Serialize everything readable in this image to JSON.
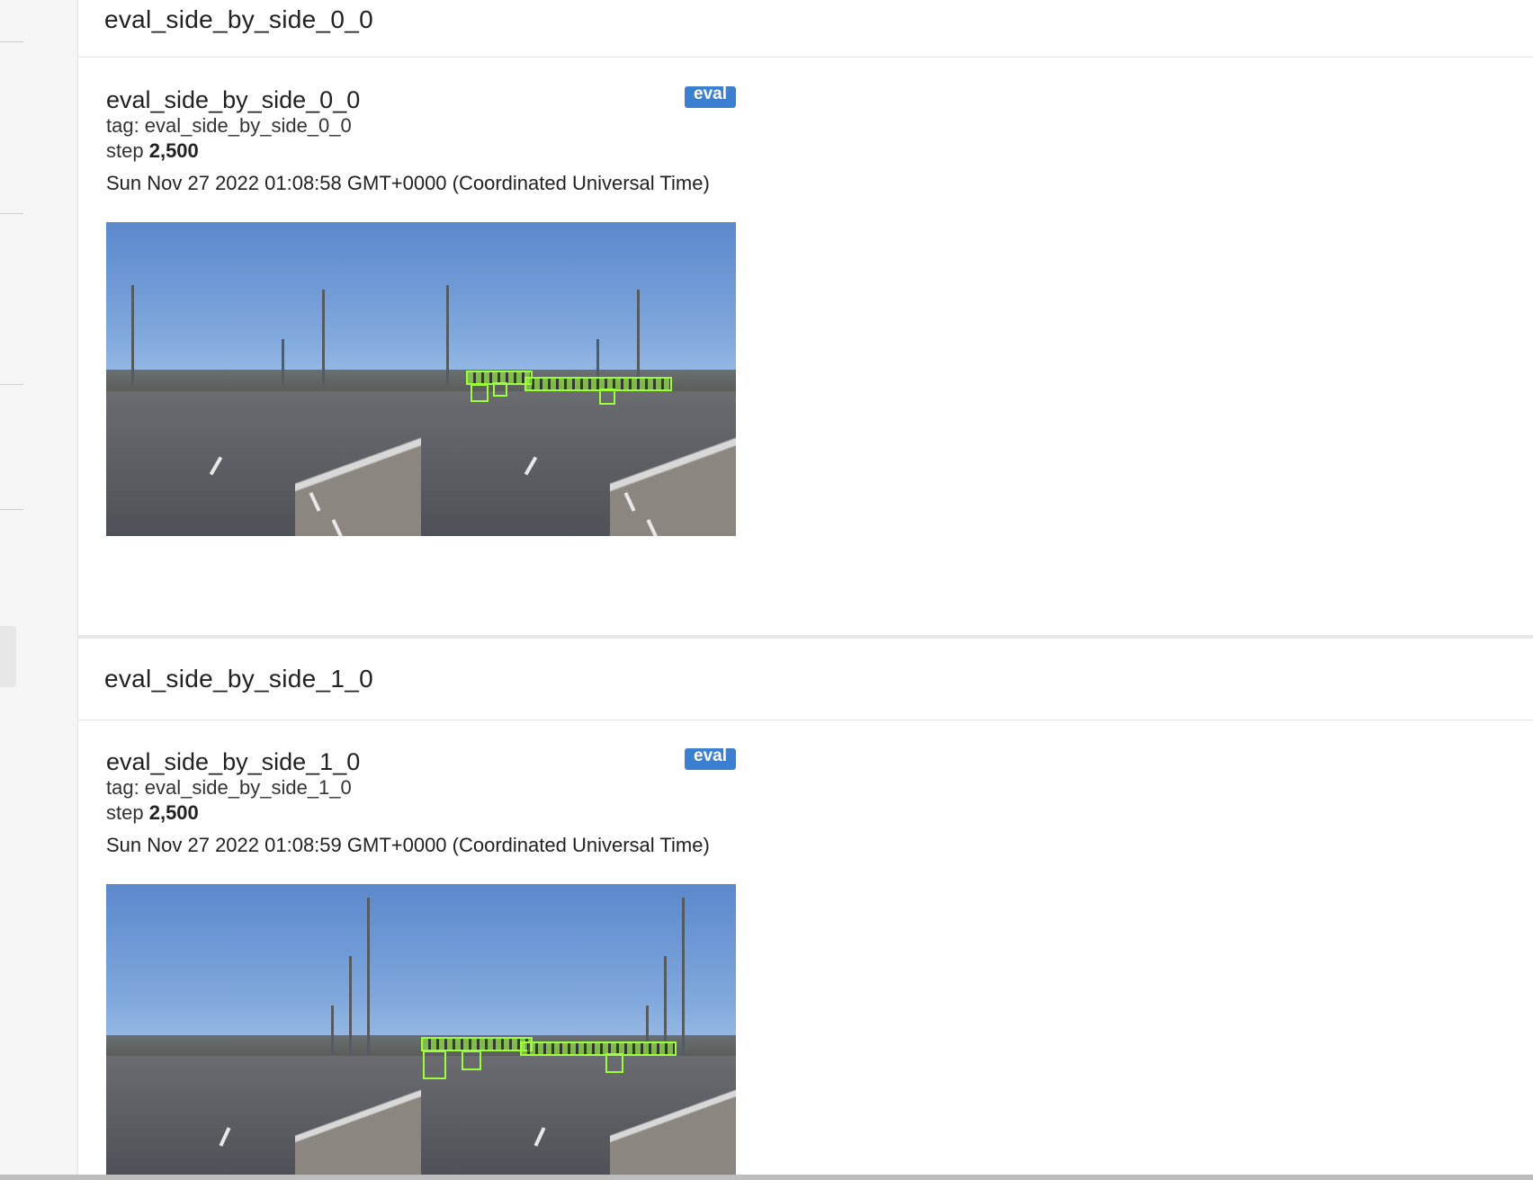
{
  "sections": [
    {
      "header_title": "eval_side_by_side_0_0",
      "card": {
        "title": "eval_side_by_side_0_0",
        "badge": "eval",
        "tag_label": "tag: eval_side_by_side_0_0",
        "step_label": "step",
        "step_value": "2,500",
        "timestamp": "Sun Nov 27 2022 01:08:58 GMT+0000 (Coordinated Universal Time)"
      }
    },
    {
      "header_title": "eval_side_by_side_1_0",
      "card": {
        "title": "eval_side_by_side_1_0",
        "badge": "eval",
        "tag_label": "tag: eval_side_by_side_1_0",
        "step_label": "step",
        "step_value": "2,500",
        "timestamp": "Sun Nov 27 2022 01:08:59 GMT+0000 (Coordinated Universal Time)"
      }
    }
  ],
  "colors": {
    "badge": "#3a7fd0",
    "detection_box": "#9dff3c"
  }
}
